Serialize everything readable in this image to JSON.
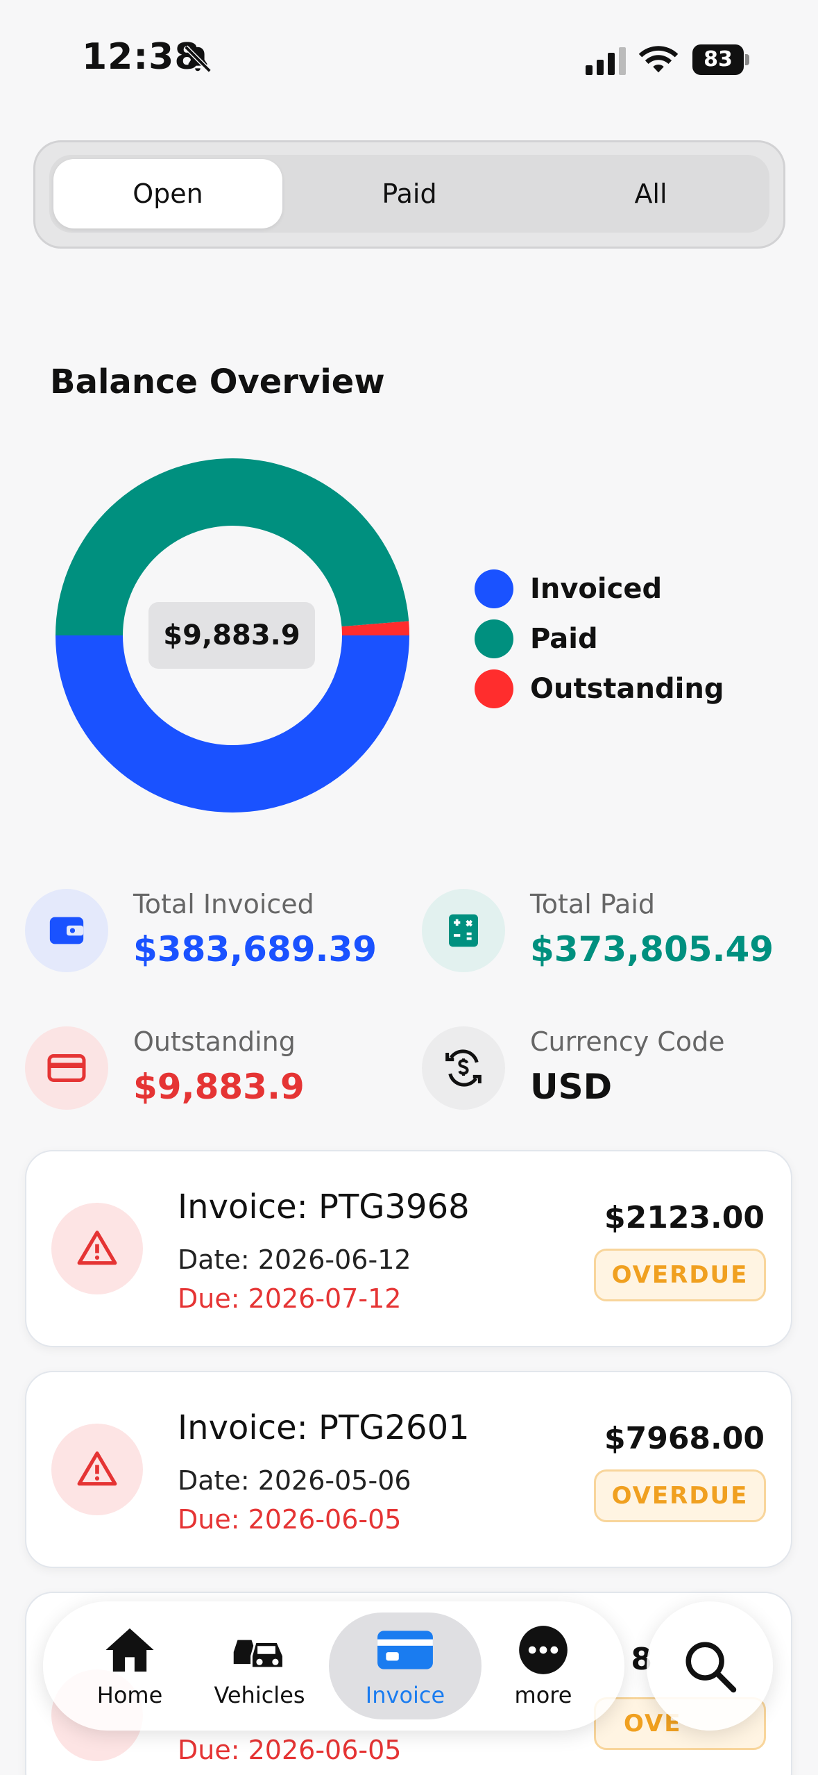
{
  "status_bar": {
    "time": "12:38",
    "battery": "83"
  },
  "tabs": [
    {
      "label": "Open",
      "active": true
    },
    {
      "label": "Paid",
      "active": false
    },
    {
      "label": "All",
      "active": false
    }
  ],
  "overview": {
    "title": "Balance Overview",
    "center_value": "$9,883.9"
  },
  "chart_data": {
    "type": "pie",
    "series": [
      {
        "name": "Invoiced",
        "value": 383689.39,
        "color": "#1a52ff"
      },
      {
        "name": "Paid",
        "value": 373805.49,
        "color": "#00907f"
      },
      {
        "name": "Outstanding",
        "value": 9883.9,
        "color": "#ff2d2d"
      }
    ],
    "legend_position": "right"
  },
  "stats": {
    "total_invoiced": {
      "label": "Total Invoiced",
      "value": "$383,689.39",
      "color": "#1a52ff",
      "icon": "wallet-icon"
    },
    "total_paid": {
      "label": "Total Paid",
      "value": "$373,805.49",
      "color": "#00907f",
      "icon": "calculator-icon"
    },
    "outstanding": {
      "label": "Outstanding",
      "value": "$9,883.9",
      "color": "#e53434",
      "icon": "credit-card-icon"
    },
    "currency": {
      "label": "Currency Code",
      "value": "USD",
      "color": "#111111",
      "icon": "currency-exchange-icon"
    }
  },
  "invoices": [
    {
      "title": "Invoice: PTG3968",
      "date": "Date: 2026-06-12",
      "due": "Due: 2026-07-12",
      "amount": "$2123.00",
      "status": "OVERDUE"
    },
    {
      "title": "Invoice: PTG2601",
      "date": "Date: 2026-05-06",
      "due": "Due: 2026-06-05",
      "amount": "$7968.00",
      "status": "OVERDUE"
    },
    {
      "title": "",
      "date": "",
      "due": "Due: 2026-06-05",
      "amount": "8",
      "status": "OVE"
    }
  ],
  "nav": {
    "items": [
      {
        "label": "Home",
        "icon": "home-icon"
      },
      {
        "label": "Vehicles",
        "icon": "vehicles-icon"
      },
      {
        "label": "Invoice",
        "icon": "invoice-icon",
        "active": true
      },
      {
        "label": "more",
        "icon": "more-icon"
      }
    ],
    "active_color": "#1a7cf0"
  }
}
